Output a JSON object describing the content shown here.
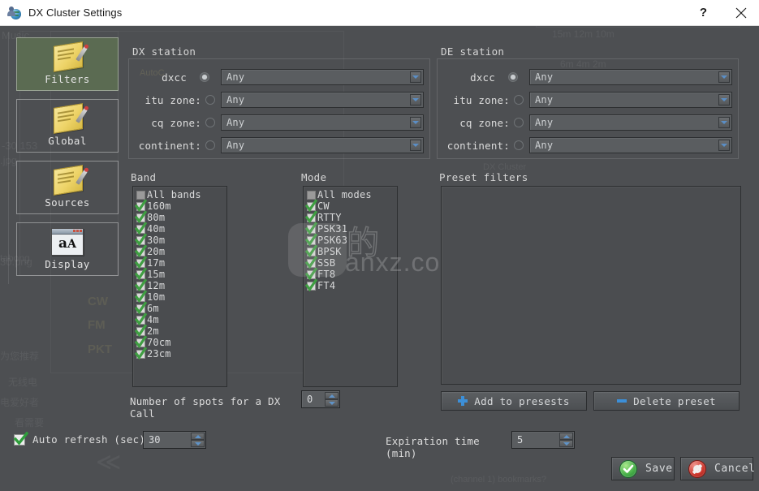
{
  "window": {
    "title": "DX Cluster Settings",
    "app_icon": "globe-person-icon",
    "help_label": "?",
    "close_label": "close-icon"
  },
  "sidebar": {
    "items": [
      {
        "label": "Filters",
        "icon": "notepad-icon",
        "selected": true
      },
      {
        "label": "Global",
        "icon": "notepad-icon",
        "selected": false
      },
      {
        "label": "Sources",
        "icon": "notepad-icon",
        "selected": false
      },
      {
        "label": "Display",
        "icon": "font-window-icon",
        "selected": false
      }
    ]
  },
  "dx_station": {
    "title": "DX station",
    "rows": [
      {
        "label": "dxcc",
        "selected": true,
        "value": "Any"
      },
      {
        "label": "itu zone:",
        "selected": false,
        "value": "Any"
      },
      {
        "label": "cq zone:",
        "selected": false,
        "value": "Any"
      },
      {
        "label": "continent:",
        "selected": false,
        "value": "Any"
      }
    ]
  },
  "de_station": {
    "title": "DE station",
    "rows": [
      {
        "label": "dxcc",
        "selected": true,
        "value": "Any"
      },
      {
        "label": "itu zone:",
        "selected": false,
        "value": "Any"
      },
      {
        "label": "cq zone:",
        "selected": false,
        "value": "Any"
      },
      {
        "label": "continent:",
        "selected": false,
        "value": "Any"
      }
    ]
  },
  "band": {
    "title": "Band",
    "items": [
      {
        "label": "All bands",
        "checked": false
      },
      {
        "label": "160m",
        "checked": true
      },
      {
        "label": "80m",
        "checked": true
      },
      {
        "label": "40m",
        "checked": true
      },
      {
        "label": "30m",
        "checked": true
      },
      {
        "label": "20m",
        "checked": true
      },
      {
        "label": "17m",
        "checked": true
      },
      {
        "label": "15m",
        "checked": true
      },
      {
        "label": "12m",
        "checked": true
      },
      {
        "label": "10m",
        "checked": true
      },
      {
        "label": "6m",
        "checked": true
      },
      {
        "label": "4m",
        "checked": true
      },
      {
        "label": "2m",
        "checked": true
      },
      {
        "label": "70cm",
        "checked": true
      },
      {
        "label": "23cm",
        "checked": true
      }
    ]
  },
  "mode": {
    "title": "Mode",
    "items": [
      {
        "label": "All modes",
        "checked": false
      },
      {
        "label": "CW",
        "checked": true
      },
      {
        "label": "RTTY",
        "checked": true
      },
      {
        "label": "PSK31",
        "checked": true
      },
      {
        "label": "PSK63",
        "checked": true
      },
      {
        "label": "BPSK",
        "checked": true
      },
      {
        "label": "SSB",
        "checked": true
      },
      {
        "label": "FT8",
        "checked": true
      },
      {
        "label": "FT4",
        "checked": true
      }
    ]
  },
  "presets": {
    "title": "Preset filters",
    "items": [],
    "add_label": "Add to presests",
    "delete_label": "Delete preset",
    "add_icon": "plus-icon",
    "delete_icon": "minus-icon"
  },
  "spots": {
    "label": "Number of spots for a DX Call",
    "value": "0"
  },
  "auto_refresh": {
    "label": "Auto refresh (sec)",
    "checked": true,
    "value": "30"
  },
  "expiration": {
    "label": "Expiration time (min)",
    "value": "5"
  },
  "footer": {
    "save_label": "Save",
    "cancel_label": "Cancel",
    "save_icon": "check-circle-icon",
    "cancel_icon": "deny-circle-icon"
  },
  "watermark": {
    "text": "anxz.com"
  },
  "colors": {
    "window_bg": "#4d4f52",
    "titlebar_bg": "#ffffff",
    "selected_tab": "#5b6b52",
    "accent_blue": "#3c8fd8",
    "check_green": "#49b24a",
    "cancel_red": "#d1392f",
    "text": "#dcdcdc"
  }
}
